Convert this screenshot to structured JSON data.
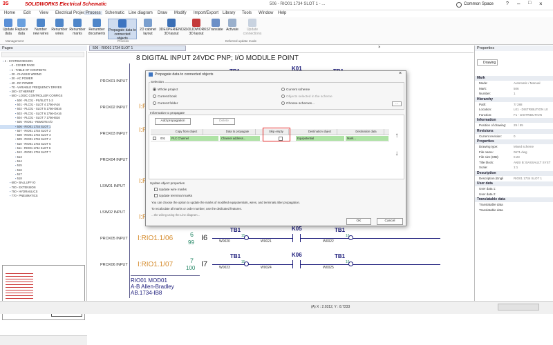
{
  "titlebar": {
    "app": "SOLIDWORKS Electrical Schematic",
    "document": "506 - RIO01 1734 SLOT 1 - ...",
    "user": "Common Space"
  },
  "menu": [
    "Home",
    "Edit",
    "View",
    "Electrical Project",
    "Process",
    "Schematic",
    "Line diagram",
    "Draw",
    "Modify",
    "Import/Export",
    "Library",
    "Tools",
    "Window",
    "Help"
  ],
  "ribbon": {
    "buttons": [
      "Update data",
      "Replace data",
      "Number new wires",
      "Renumber wires",
      "Renumber marks",
      "Renumber documents",
      "Propagate data to connected objects",
      "2D cabinet layout",
      "3DEXPERIENCE 3D layout",
      "SOLIDWORKS 3D layout",
      "Translate",
      "Activate",
      "Update connections"
    ],
    "groups": [
      "Management",
      "Process",
      "Deferred update mode"
    ]
  },
  "pages": {
    "title": "Pages",
    "items": [
      "1 - SYSTEM DESIGN",
      "0 - COVER PAGE",
      "1 - TABLE OF CONTENTS",
      "20 - CHASSIS WIRING",
      "30 - AC POWER",
      "40 - DC POWER",
      "70 - VARIABLE FREQUENCY DRIVES",
      "300 - ETHERNET",
      "500 - LOGIC CONTROLLER CONFIGS",
      "500 - PLC01 - PS/SLOT 1-3",
      "501 - PLC01 - SLOT 4 1756-IA16",
      "502 - PLC01 - SLOT 5 1756-OB16",
      "503 - PLC01 - SLOT 6 1756-OA16",
      "504 - PLC01 - SLOT 7 1756-IB16",
      "505 - RIO01 - REMOTE I/O",
      "506 - RIO01 1734 SLOT 1",
      "507 - RIO01 1734 SLOT 2",
      "508 - RIO01 1734 SLOT 3",
      "509 - RIO01 1734 SLOT 4",
      "510 - RIO01 1734 SLOT 5",
      "511 - RIO01 1734 SLOT 6",
      "512 - RIO01 1734 SLOT 7",
      "513",
      "514",
      "515",
      "516",
      "517",
      "518",
      "600 - BALLUFF IO",
      "700 - EXTENSION",
      "750 - HYDRAULICS",
      "770 - PNEUMATICS"
    ]
  },
  "tab": {
    "label": "506 - RIO01 1734 SLOT 1"
  },
  "schematic": {
    "heading": "8 DIGITAL INPUT 24VDC PNP; I/O MODULE POINT",
    "left_labels": [
      "PROX01 INPUT",
      "PROX02 INPUT",
      "PROX03 INPUT",
      "PROX04 INPUT",
      "LSW01 INPUT",
      "LSW02 INPUT",
      "PROX05 INPUT",
      "PROX06 INPUT"
    ],
    "rows": [
      {
        "ref": "I:RIO1.1/06",
        "num": "6",
        "sub": "99",
        "i": "I6",
        "wires": [
          "W0020",
          "W0021",
          "W0022"
        ],
        "k": "K05"
      },
      {
        "ref": "I:RIO1.1/07",
        "num": "7",
        "sub": "100",
        "i": "I7",
        "wires": [
          "W0023",
          "W0024",
          "W0025"
        ],
        "k": "K06"
      }
    ],
    "tb": [
      "TB1",
      "TB1",
      "TB1",
      "TB1"
    ],
    "tb_sub": [
      "15",
      "16",
      "15",
      "16"
    ],
    "top_tb": [
      "TB1",
      "K01",
      "TB1"
    ],
    "side_refs": [
      "I:R",
      "I:R",
      "I:R",
      "I:R"
    ],
    "module": {
      "line1": "RIO01 MOD01",
      "line2": "A-B Allen-Bradley",
      "line3": "AB.1734-IB8"
    }
  },
  "properties": {
    "title": "Properties",
    "tab": "Drawing",
    "sections": [
      {
        "head": "Mark",
        "rows": [
          [
            "Mode:",
            "Automatic / Manual"
          ],
          [
            "Mark:",
            "506"
          ],
          [
            "Number:",
            "1"
          ]
        ]
      },
      {
        "head": "Hierarchy",
        "rows": [
          [
            "Path:",
            "7/ 288"
          ],
          [
            "Location:",
            "L01 - DISTRIBUTION L0"
          ],
          [
            "Function:",
            "F1 - DISTRIBUTION"
          ]
        ]
      },
      {
        "head": "Information",
        "rows": [
          [
            "Position of drawing:",
            "29 / 55"
          ]
        ]
      },
      {
        "head": "Revisions",
        "rows": [
          [
            "Current revision:",
            "0"
          ]
        ]
      },
      {
        "head": "Properties",
        "rows": [
          [
            "Drawing type:",
            "Mixed scheme"
          ],
          [
            "File name:",
            "0671.dwg"
          ],
          [
            "File size (MB):",
            "0.23"
          ],
          [
            "Title block:",
            "ANSI B: BASSAULT SYST"
          ],
          [
            "Scale:",
            "1:1"
          ]
        ]
      },
      {
        "head": "Description",
        "rows": [
          [
            "Description (Engli",
            "RIO01 1734 SLOT 1"
          ]
        ]
      },
      {
        "head": "User data",
        "rows": [
          [
            "User data 1:",
            ""
          ],
          [
            "User data 2:",
            ""
          ]
        ]
      },
      {
        "head": "Translatable data",
        "rows": [
          [
            "Translatable data",
            ""
          ],
          [
            "Translatable data",
            ""
          ]
        ]
      }
    ]
  },
  "dialog": {
    "title": "Propagate data to connected objects",
    "selection_label": "Selection",
    "options_left": [
      "Whole project",
      "Current book",
      "Current folder"
    ],
    "options_right": [
      "Current scheme",
      "Objects selected in the scheme",
      "Choose schemes..."
    ],
    "info_label": "Information to propagate",
    "add_btn": "Add propagation",
    "delete_btn": "Delete",
    "columns": [
      "Copy from object",
      "Data to propagate",
      "Skip empty",
      "Destination object",
      "Destination data"
    ],
    "row": {
      "num": "001",
      "from": "PLC Channel",
      "data": "Channel address...",
      "dest": "Equipotential",
      "dest_data": "Mark..."
    },
    "update_label": "Update object properties",
    "chk1": "Update wire marks",
    "chk2": "Update terminal marks",
    "note1": "You can choose the option to update the marks of modified equipotentials, wires, and terminals after propagation.",
    "note2": "To recalculate all marks or order number, use the dedicated features.",
    "note3": "...the wiring using the Line diagram...",
    "ok": "OK",
    "cancel": "Cancel"
  },
  "status": {
    "coords": "(A) X : 2.0312, Y : 8.7233"
  }
}
